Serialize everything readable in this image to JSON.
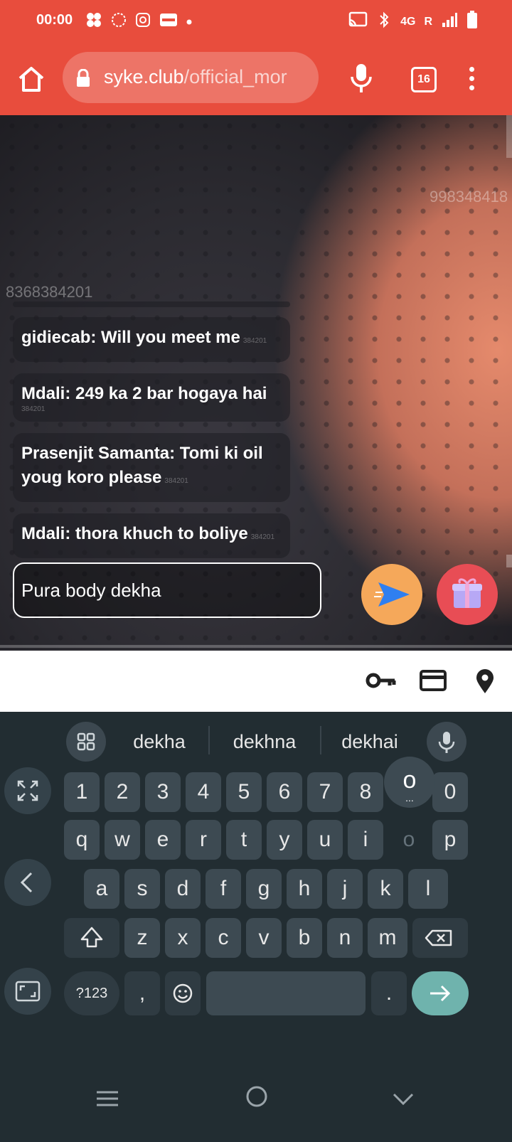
{
  "status_bar": {
    "time": "00:00",
    "network": "4G",
    "roaming": "R"
  },
  "browser": {
    "url_domain": "syke.club",
    "url_path": "/official_mor",
    "tab_count": "16"
  },
  "stream": {
    "watermark_top": "998348418",
    "watermark_left": "8368384201",
    "messages": [
      {
        "text": "gidiecab: Will you meet me",
        "tag": "384201"
      },
      {
        "text": "Mdali: 249 ka 2 bar hogaya hai",
        "tag": "384201"
      },
      {
        "text": "Prasenjit Samanta: Tomi ki oil youg koro please",
        "tag": "384201"
      },
      {
        "text": "Mdali: thora khuch to boliye",
        "tag": "384201"
      }
    ],
    "chat_input_value": "Pura body dekha"
  },
  "keyboard": {
    "suggestions": [
      "dekha",
      "dekhna",
      "dekhai"
    ],
    "row_numbers": [
      "1",
      "2",
      "3",
      "4",
      "5",
      "6",
      "7",
      "8",
      "0"
    ],
    "row1": [
      "q",
      "w",
      "e",
      "r",
      "t",
      "y",
      "u",
      "i",
      "o",
      "p"
    ],
    "row2": [
      "a",
      "s",
      "d",
      "f",
      "g",
      "h",
      "j",
      "k",
      "l"
    ],
    "row3": [
      "z",
      "x",
      "c",
      "v",
      "b",
      "n",
      "m"
    ],
    "popup_key": "o",
    "popup_more": "...",
    "symbols_key": "?123",
    "comma_key": ",",
    "period_key": "."
  },
  "colors": {
    "browser_bar": "#e84d3d",
    "send_button": "#f5a85a",
    "gift_button": "#e84d55",
    "enter_key": "#6fb3ad",
    "keyboard_bg": "#222d32"
  }
}
